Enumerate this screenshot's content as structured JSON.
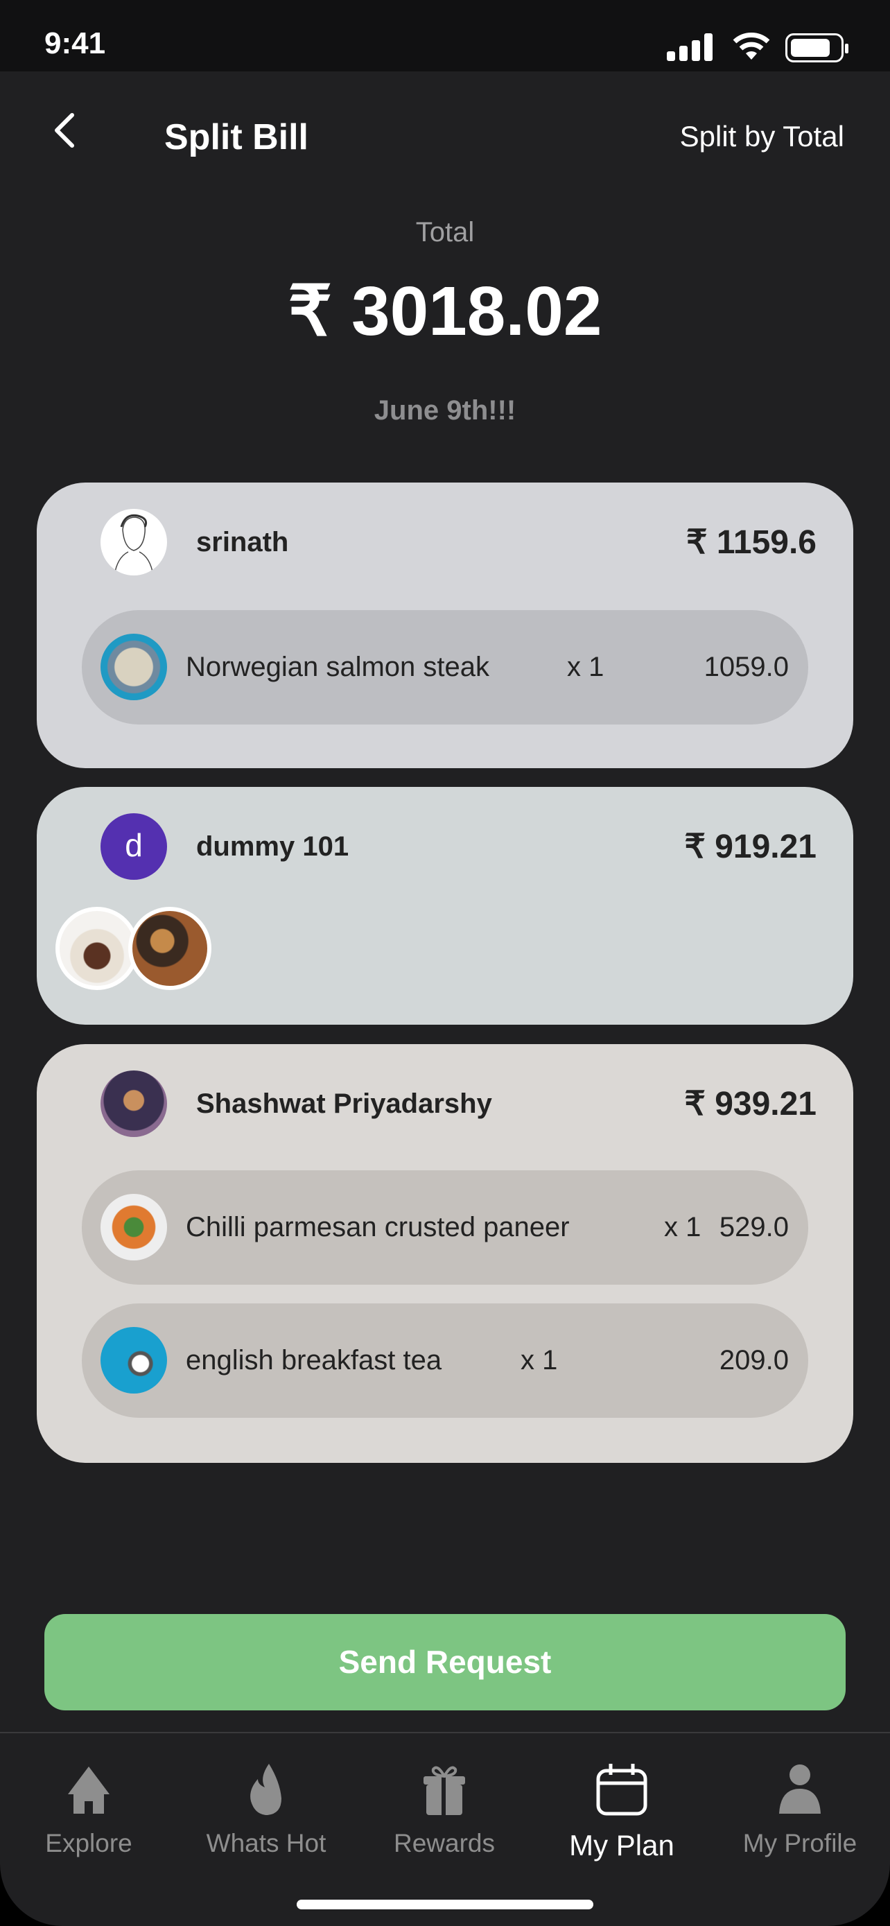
{
  "status": {
    "time": "9:41"
  },
  "header": {
    "title": "Split Bill",
    "action": "Split by Total"
  },
  "summary": {
    "label": "Total",
    "amount": "₹ 3018.02",
    "note": "June 9th!!!"
  },
  "participants": [
    {
      "name": "srinath",
      "amount": "₹ 1159.6",
      "items": [
        {
          "name": "Norwegian salmon steak",
          "qty": "x 1",
          "price": "1059.0"
        }
      ]
    },
    {
      "name": "dummy 101",
      "initial": "d",
      "amount": "₹ 919.21",
      "avatar_color": "#5430b0"
    },
    {
      "name": "Shashwat Priyadarshy",
      "amount": "₹ 939.21",
      "items": [
        {
          "name": "Chilli parmesan crusted paneer",
          "qty": "x 1",
          "price": "529.0"
        },
        {
          "name": "english breakfast tea",
          "qty": "x 1",
          "price": "209.0"
        }
      ]
    }
  ],
  "send_label": "Send Request",
  "nav": [
    {
      "label": "Explore",
      "icon": "home-icon"
    },
    {
      "label": "Whats Hot",
      "icon": "flame-icon"
    },
    {
      "label": "Rewards",
      "icon": "gift-icon"
    },
    {
      "label": "My Plan",
      "icon": "calendar-icon",
      "active": true
    },
    {
      "label": "My Profile",
      "icon": "person-icon"
    }
  ],
  "colors": {
    "accent": "#7dc582",
    "bg": "#202022"
  }
}
